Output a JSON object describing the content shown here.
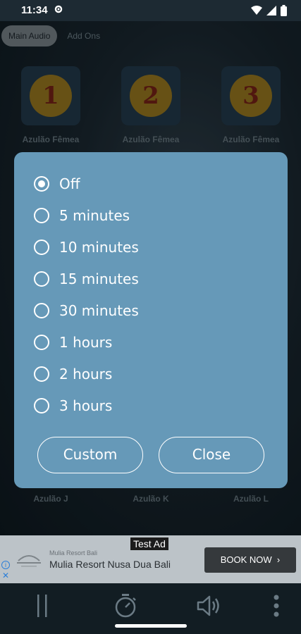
{
  "status_bar": {
    "time": "11:34"
  },
  "tabs": [
    {
      "label": "Main Audio",
      "active": true
    },
    {
      "label": "Add Ons",
      "active": false
    }
  ],
  "sounds": [
    {
      "number": "1",
      "label": "Azulão Fêmea"
    },
    {
      "number": "2",
      "label": "Azulão Fêmea"
    },
    {
      "number": "3",
      "label": "Azulão Fêmea"
    }
  ],
  "bottom_labels": [
    "Azulão J",
    "Azulão K",
    "Azulão L"
  ],
  "timer_dialog": {
    "options": [
      {
        "label": "Off",
        "selected": true
      },
      {
        "label": "5 minutes",
        "selected": false
      },
      {
        "label": "10 minutes",
        "selected": false
      },
      {
        "label": "15 minutes",
        "selected": false
      },
      {
        "label": "30 minutes",
        "selected": false
      },
      {
        "label": "1 hours",
        "selected": false
      },
      {
        "label": "2 hours",
        "selected": false
      },
      {
        "label": "3 hours",
        "selected": false
      }
    ],
    "custom_label": "Custom",
    "close_label": "Close"
  },
  "ad": {
    "tag": "Test Ad",
    "advertiser": "Mulia Resort Bali",
    "title": "Mulia Resort Nusa Dua Bali",
    "cta": "BOOK NOW"
  },
  "toolbar_icons": [
    "pause-icon",
    "timer-icon",
    "volume-icon",
    "more-vert-icon"
  ],
  "colors": {
    "dialog_bg": "#6699b8",
    "accent_white": "#ffffff",
    "ad_bg": "#bcc3c8"
  }
}
